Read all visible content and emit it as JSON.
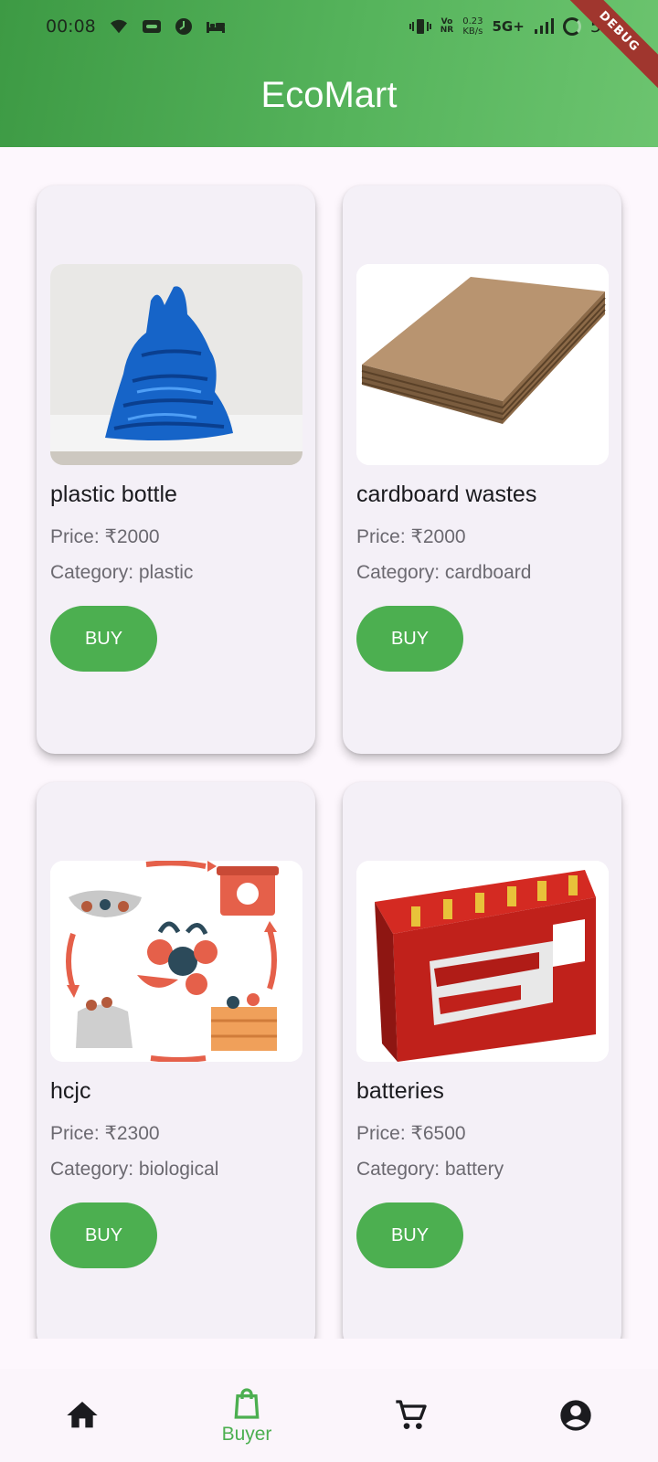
{
  "status_bar": {
    "time": "00:08",
    "volte": "Vo\nNR",
    "speed": "0.23\nKB/s",
    "network": "5G+",
    "battery": "58"
  },
  "debug_label": "DEBUG",
  "app": {
    "title": "EcoMart"
  },
  "products": [
    {
      "name": "plastic bottle",
      "price": "Price: ₹2000",
      "category": "Category: plastic",
      "buy_label": "BUY",
      "image": "blue-plastic-bags"
    },
    {
      "name": "cardboard wastes",
      "price": "Price: ₹2000",
      "category": "Category: cardboard",
      "buy_label": "BUY",
      "image": "cardboard-stack"
    },
    {
      "name": "hcjc",
      "price": "Price: ₹2300",
      "category": "Category: biological",
      "buy_label": "BUY",
      "image": "biological-waste-cycle"
    },
    {
      "name": "batteries",
      "price": "Price: ₹6500",
      "category": "Category: battery",
      "buy_label": "BUY",
      "image": "red-exide-battery"
    }
  ],
  "bottom_nav": {
    "items": [
      {
        "icon": "home-icon",
        "label": ""
      },
      {
        "icon": "shopping-bag-icon",
        "label": "Buyer",
        "active": true
      },
      {
        "icon": "cart-icon",
        "label": ""
      },
      {
        "icon": "account-icon",
        "label": ""
      }
    ]
  },
  "colors": {
    "primary": "#4caf50",
    "appbar_start": "#3d9a44",
    "appbar_end": "#6cc46f",
    "background": "#fdf7fd"
  }
}
